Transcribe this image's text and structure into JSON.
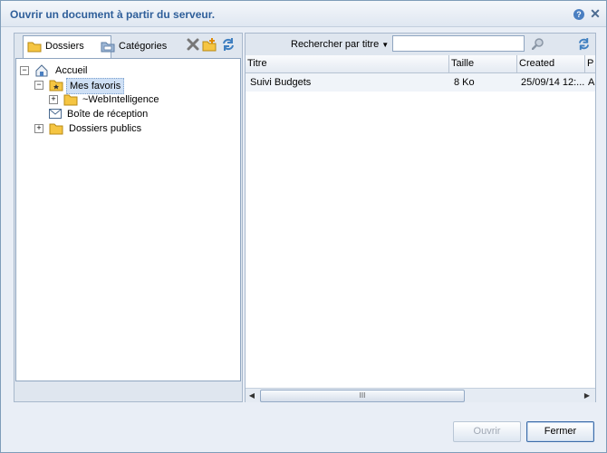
{
  "dialog": {
    "title": "Ouvrir un document à partir du serveur.",
    "help_label": "?",
    "close_label": "✕"
  },
  "left": {
    "tabs": [
      {
        "label": "Dossiers",
        "active": true,
        "icon": "folder-icon"
      },
      {
        "label": "Catégories",
        "active": false,
        "icon": "category-icon"
      }
    ],
    "tools": [
      "delete-icon",
      "new-folder-icon",
      "refresh-icon"
    ],
    "tree": [
      {
        "label": "Accueil",
        "icon": "home-icon",
        "expander": "−"
      },
      {
        "label": "Mes favoris",
        "icon": "favorites-folder-icon",
        "expander": "−",
        "selected": true
      },
      {
        "label": "~WebIntelligence",
        "icon": "folder-icon",
        "expander": "+"
      },
      {
        "label": "Boîte de réception",
        "icon": "inbox-icon"
      },
      {
        "label": "Dossiers publics",
        "icon": "folder-icon",
        "expander": "+"
      }
    ]
  },
  "right": {
    "search": {
      "label": "Rechercher par titre",
      "value": "",
      "placeholder": ""
    },
    "columns": [
      "Titre",
      "Taille",
      "Created",
      "P"
    ],
    "rows": [
      {
        "title": "Suivi Budgets",
        "size": "8 Ko",
        "created": "25/09/14 12:...",
        "extra": "A"
      }
    ],
    "scrollbar": {
      "thumb_label": "III",
      "left_arrow": "◀",
      "right_arrow": "▶"
    }
  },
  "footer": {
    "open_label": "Ouvrir",
    "close_label": "Fermer"
  },
  "colors": {
    "title": "#2f5f9a",
    "accent": "#4a7fc1",
    "folder": "#f5c542"
  }
}
